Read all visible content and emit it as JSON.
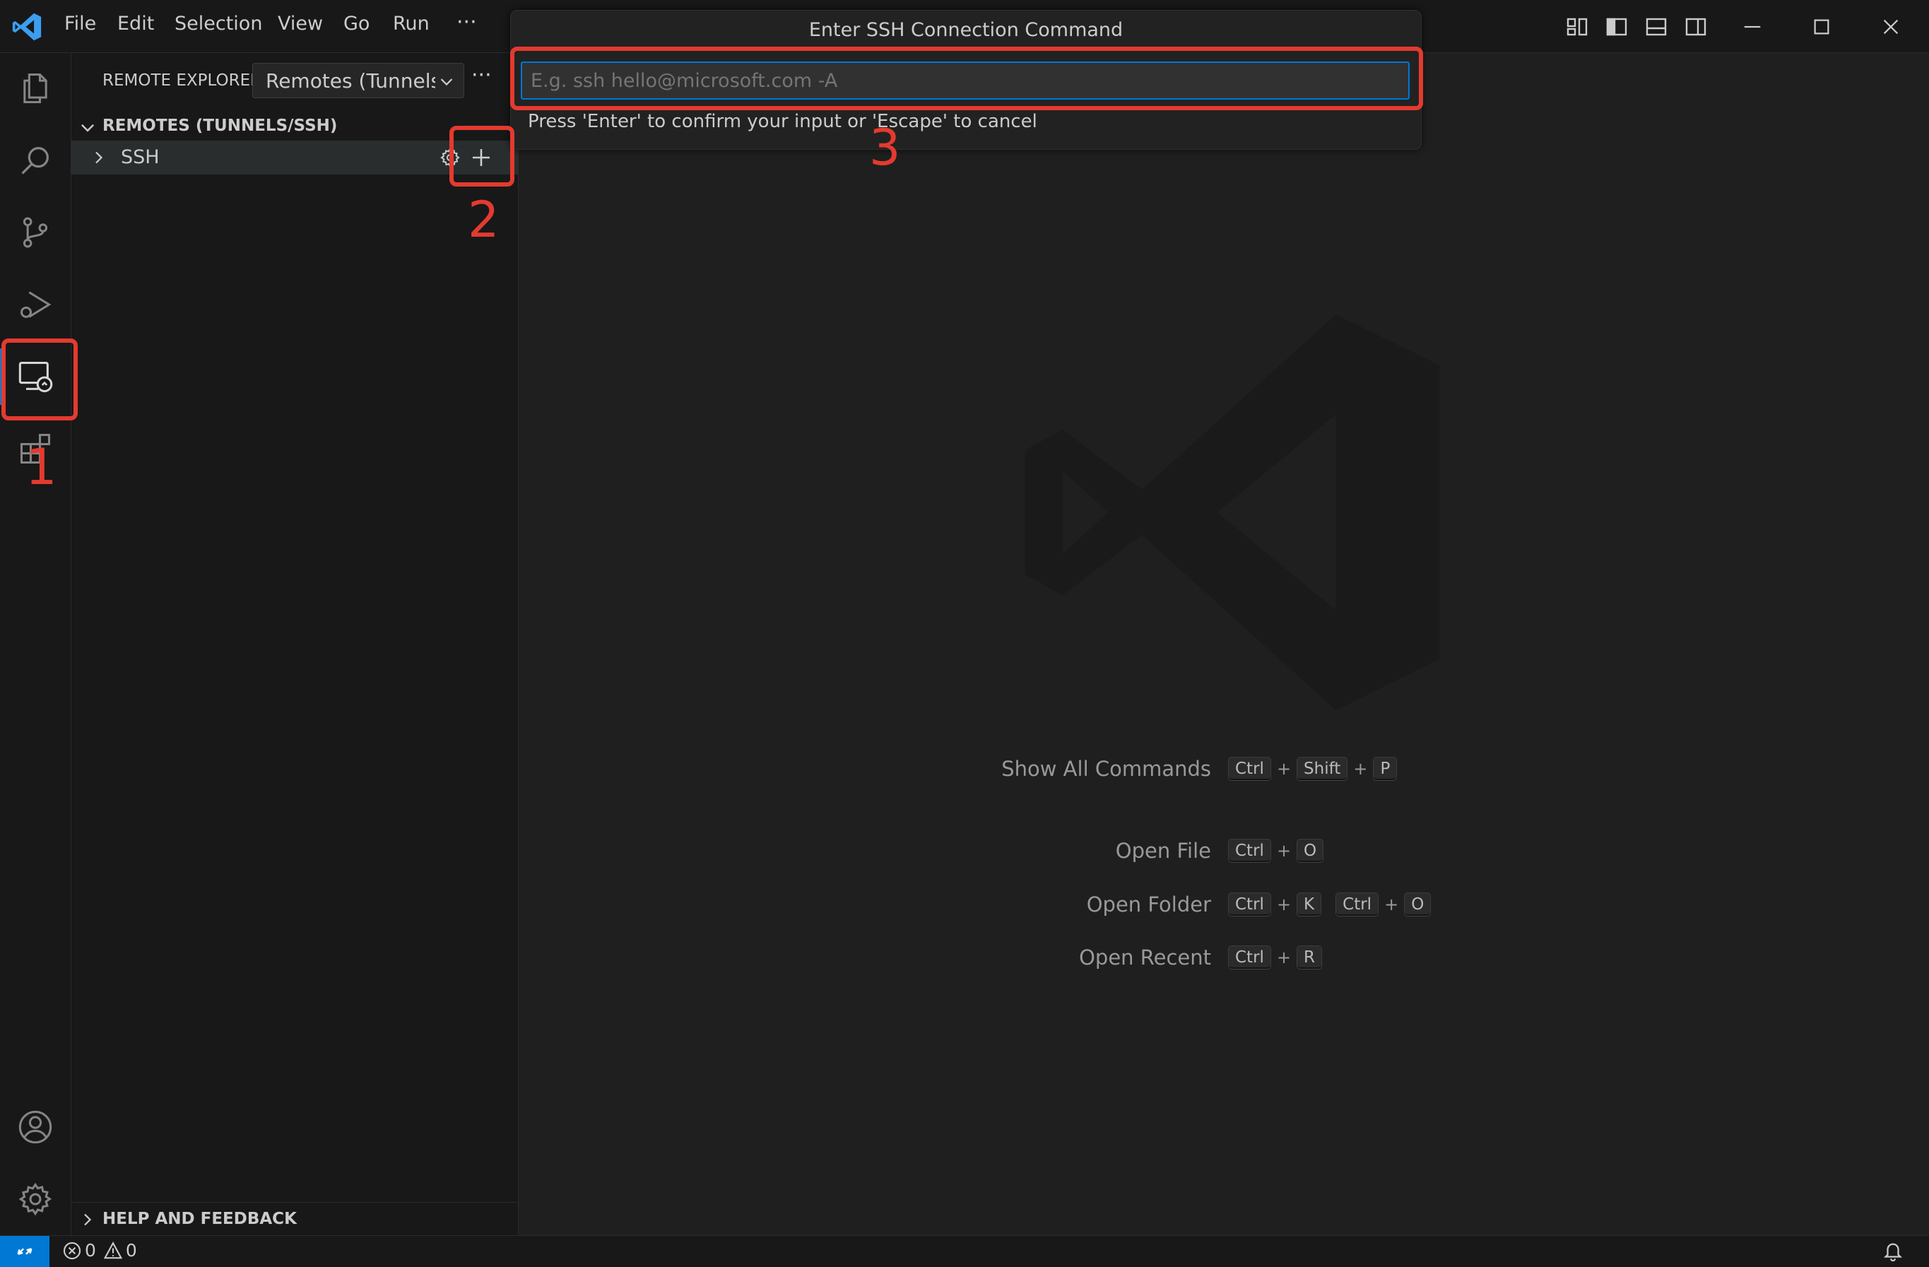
{
  "menu": [
    "File",
    "Edit",
    "Selection",
    "View",
    "Go",
    "Run"
  ],
  "menu_more": "···",
  "quick_input": {
    "title": "Enter SSH Connection Command",
    "placeholder": "E.g. ssh hello@microsoft.com -A",
    "hint": "Press 'Enter' to confirm your input or 'Escape' to cancel"
  },
  "sidebar": {
    "title": "REMOTE EXPLORER",
    "dropdown": "Remotes (Tunnels/",
    "more": "···",
    "section": "REMOTES (TUNNELS/SSH)",
    "tree_item": "SSH",
    "footer_section": "HELP AND FEEDBACK"
  },
  "shortcuts": [
    {
      "label": "Show All Commands",
      "keys": [
        [
          "Ctrl",
          "Shift",
          "P"
        ]
      ]
    },
    {
      "label": "Open File",
      "keys": [
        [
          "Ctrl",
          "O"
        ]
      ]
    },
    {
      "label": "Open Folder",
      "keys": [
        [
          "Ctrl",
          "K"
        ],
        [
          "Ctrl",
          "O"
        ]
      ]
    },
    {
      "label": "Open Recent",
      "keys": [
        [
          "Ctrl",
          "R"
        ]
      ]
    }
  ],
  "status": {
    "errors": "0",
    "warnings": "0"
  },
  "callouts": [
    "1",
    "2",
    "3"
  ],
  "colors": {
    "accent_red": "#e43a2f",
    "remote_blue": "#0078d4",
    "vscode_blue": "#3c9ef0"
  }
}
